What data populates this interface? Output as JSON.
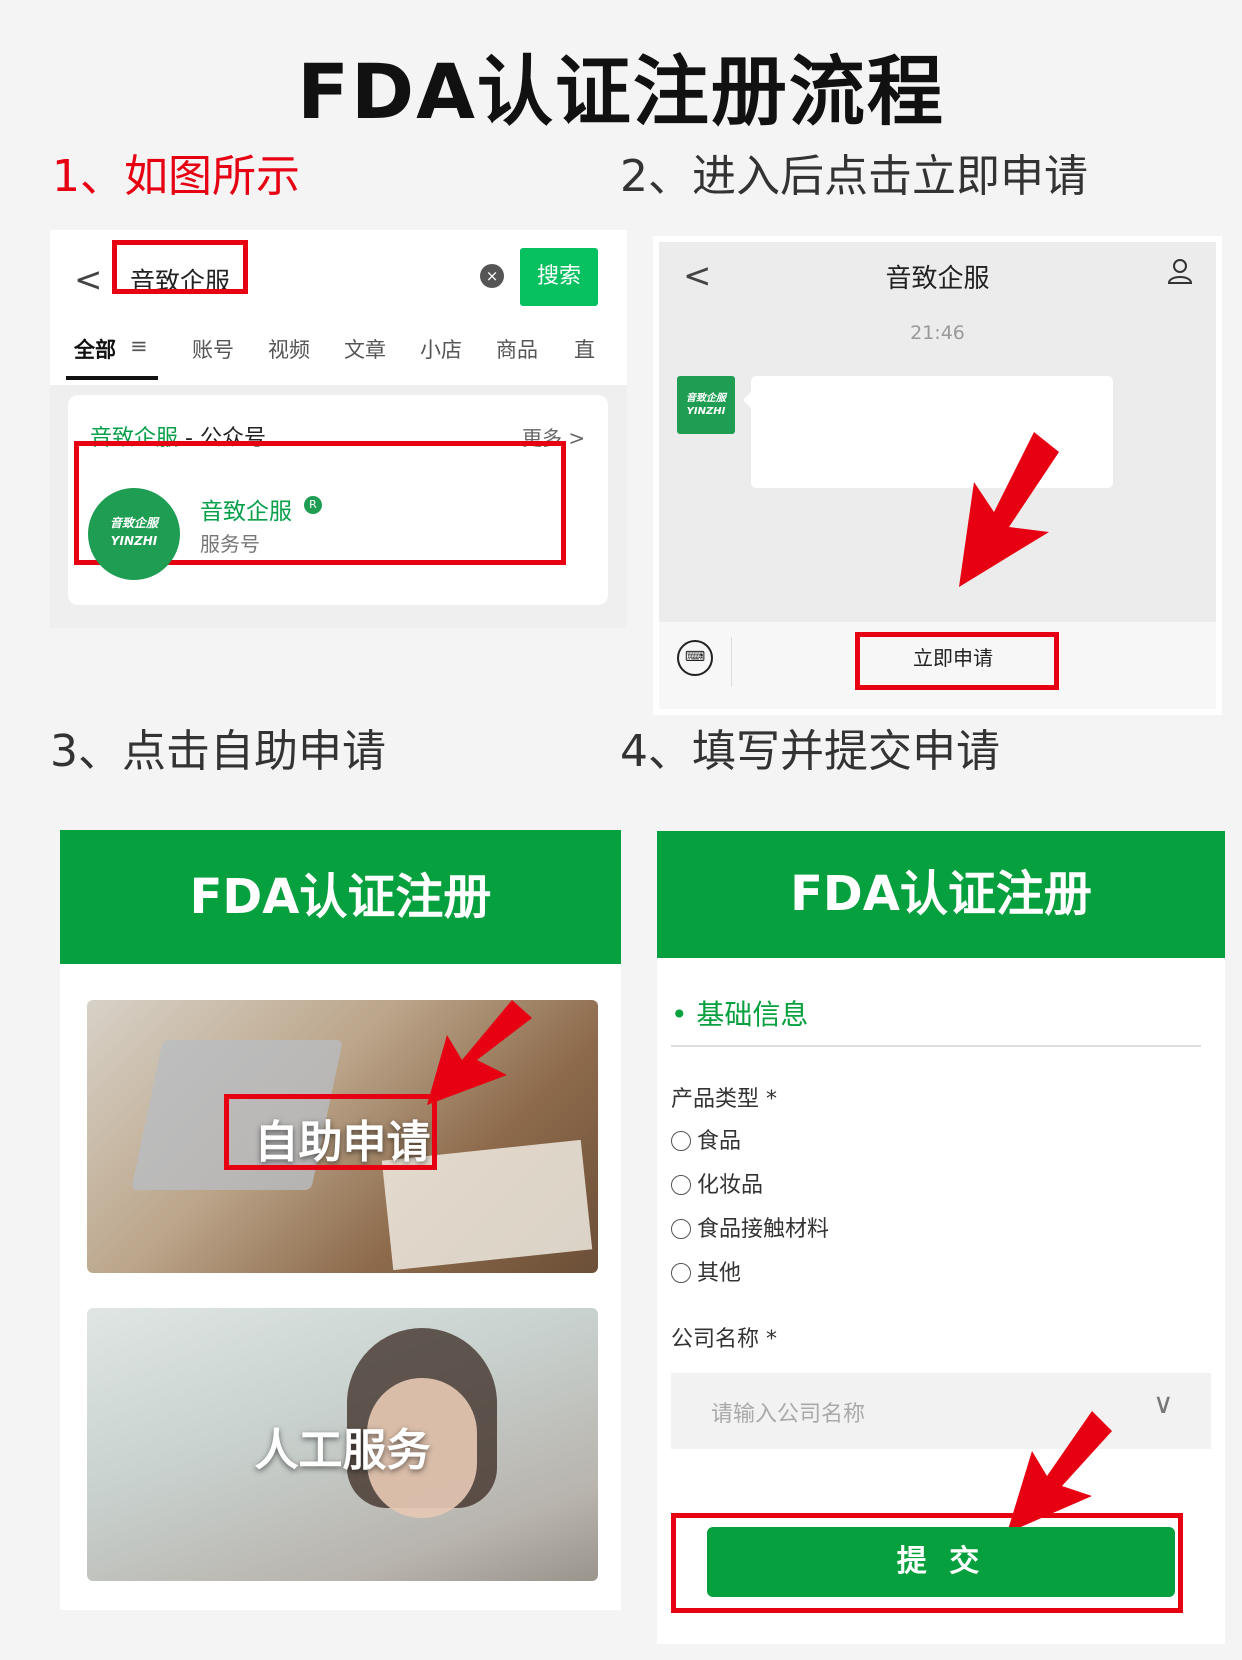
{
  "main_title": "FDA认证注册流程",
  "steps": {
    "s1": "1、如图所示",
    "s2": "2、进入后点击立即申请",
    "s3": "3、点击自助申请",
    "s4": "4、填写并提交申请"
  },
  "panel1": {
    "back": "<",
    "search_value": "音致企服",
    "clear": "×",
    "search_button": "搜索",
    "tabs": [
      "全部",
      "账号",
      "视频",
      "文章",
      "小店",
      "商品",
      "直"
    ],
    "filter_icon": "≡",
    "account_group_name": "音致企服",
    "account_group_suffix": " - 公众号",
    "more": "更多 >",
    "logo_cn": "音致企服",
    "logo_en": "YINZHI",
    "account_name": "音致企服",
    "badge": "R",
    "account_type": "服务号"
  },
  "panel2": {
    "back": "<",
    "title": "音致企服",
    "time": "21:46",
    "avatar_cn": "音致企服",
    "avatar_en": "YINZHI",
    "keyboard": "⌨",
    "apply_button": "立即申请"
  },
  "panel3": {
    "header": "FDA认证注册",
    "option1": "自助申请",
    "option2": "人工服务"
  },
  "panel4": {
    "header": "FDA认证注册",
    "section": "• 基础信息",
    "product_type_label": "产品类型 *",
    "product_types": [
      "食品",
      "化妆品",
      "食品接触材料",
      "其他"
    ],
    "company_label": "公司名称 *",
    "company_placeholder": "请输入公司名称",
    "chevron": "∨",
    "submit": "提 交"
  },
  "colors": {
    "accent_red": "#e60012",
    "brand_green": "#07a03e",
    "wechat_green": "#07c160"
  }
}
